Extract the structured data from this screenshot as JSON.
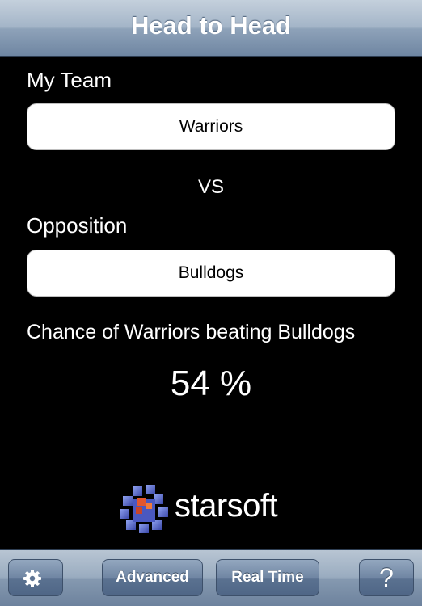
{
  "nav": {
    "title": "Head to Head"
  },
  "my_team": {
    "label": "My Team",
    "value": "Warriors"
  },
  "vs_label": "VS",
  "opposition": {
    "label": "Opposition",
    "value": "Bulldogs"
  },
  "result": {
    "text": "Chance of Warriors beating Bulldogs",
    "value": "54 %"
  },
  "logo": {
    "text": "starsoft"
  },
  "toolbar": {
    "settings_icon": "gear-icon",
    "advanced_label": "Advanced",
    "realtime_label": "Real Time",
    "help_label": "?"
  }
}
